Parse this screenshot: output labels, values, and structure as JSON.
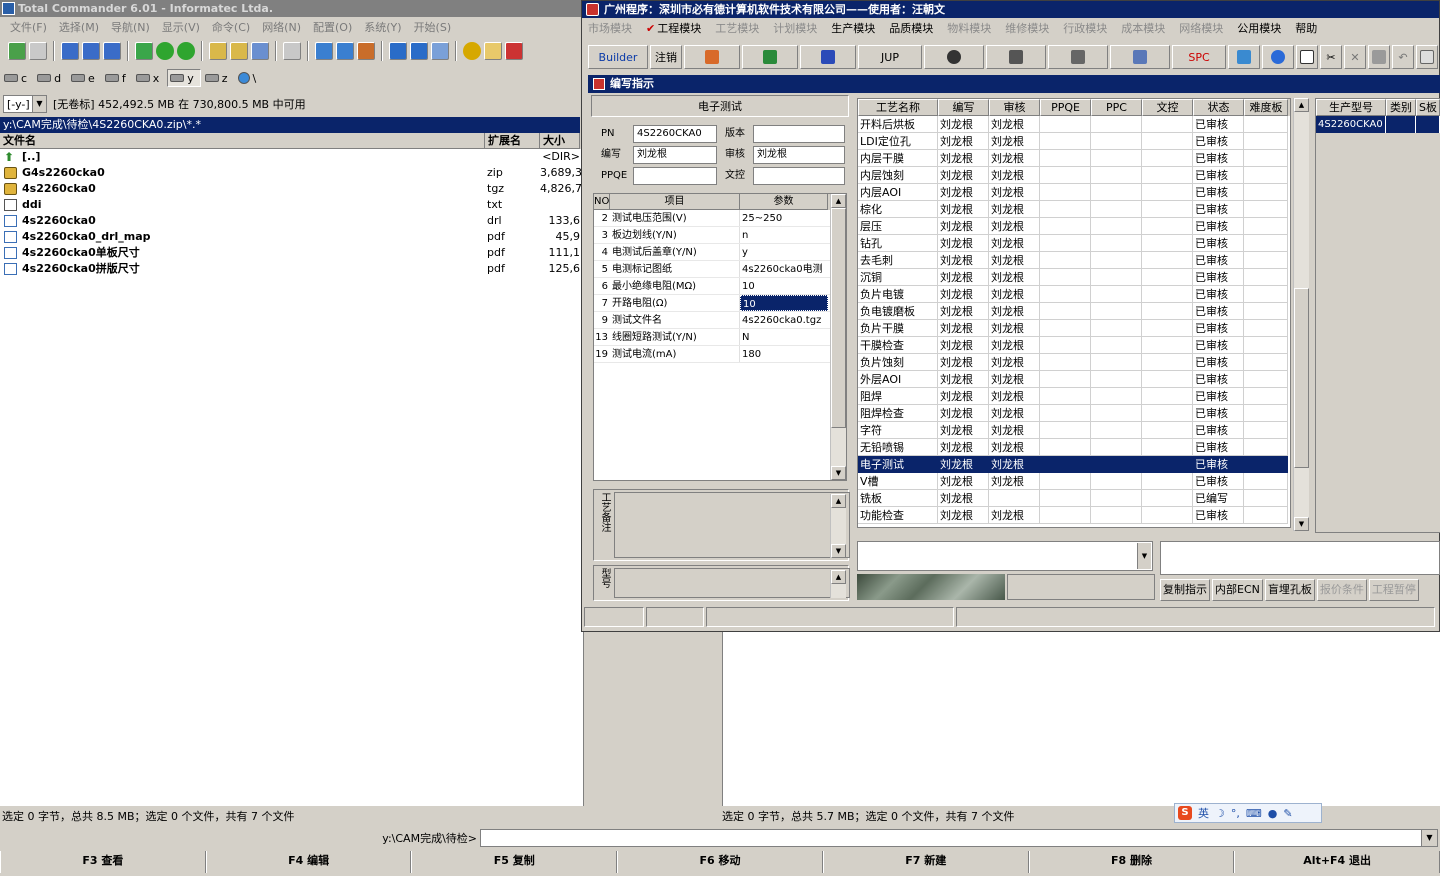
{
  "tc": {
    "title": "Total Commander 6.01 - Informatec Ltda.",
    "menu": [
      "文件(F)",
      "选择(M)",
      "导航(N)",
      "显示(V)",
      "命令(C)",
      "网络(N)",
      "配置(O)",
      "系统(Y)",
      "开始(S)"
    ],
    "drives": [
      "c",
      "d",
      "e",
      "f",
      "x",
      "y",
      "z",
      "\\"
    ],
    "drive_selector": "[-y-]",
    "disk_info": "[无卷标]  452,492.5 MB 在 730,800.5 MB 中可用",
    "current_path": "y:\\CAM完成\\待检\\4S2260CKA0.zip\\*.*",
    "columns": {
      "name": "文件名",
      "ext": "扩展名",
      "size": "大小"
    },
    "files": [
      {
        "name": "[..]",
        "ext": "",
        "size": "<DIR>",
        "icon": "up-arrow"
      },
      {
        "name": "G4s2260cka0",
        "ext": "zip",
        "size": "3,689,3",
        "icon": "archive"
      },
      {
        "name": "4s2260cka0",
        "ext": "tgz",
        "size": "4,826,7",
        "icon": "archive"
      },
      {
        "name": "ddi",
        "ext": "txt",
        "size": "",
        "icon": "text-file"
      },
      {
        "name": "4s2260cka0",
        "ext": "drl",
        "size": "133,6",
        "icon": "file"
      },
      {
        "name": "4s2260cka0_drl_map",
        "ext": "pdf",
        "size": "45,9",
        "icon": "file"
      },
      {
        "name": "4s2260cka0单板尺寸",
        "ext": "pdf",
        "size": "111,1",
        "icon": "file"
      },
      {
        "name": "4s2260cka0拼版尺寸",
        "ext": "pdf",
        "size": "125,6",
        "icon": "file"
      }
    ],
    "status_left": "选定 0 字节，总共 8.5 MB；选定 0 个文件，共有 7 个文件",
    "status_right": "选定 0 字节，总共 5.7 MB；选定 0 个文件，共有 7 个文件",
    "cmd_label": "y:\\CAM完成\\待检>",
    "fkeys": [
      "F3 查看",
      "F4 编辑",
      "F5 复制",
      "F6 移动",
      "F7 新建",
      "F8 删除",
      "Alt+F4 退出"
    ]
  },
  "ime": {
    "lang": "英"
  },
  "erp": {
    "title": "广州程序：深圳市必有德计算机软件技术有限公司——使用者：汪朝文",
    "menu": [
      {
        "label": "市场模块",
        "enabled": false
      },
      {
        "label": "工程模块",
        "enabled": true,
        "checked": true
      },
      {
        "label": "工艺模块",
        "enabled": false
      },
      {
        "label": "计划模块",
        "enabled": false
      },
      {
        "label": "生产模块",
        "enabled": true
      },
      {
        "label": "品质模块",
        "enabled": true
      },
      {
        "label": "物料模块",
        "enabled": false
      },
      {
        "label": "维修模块",
        "enabled": false
      },
      {
        "label": "行政模块",
        "enabled": false
      },
      {
        "label": "成本模块",
        "enabled": false
      },
      {
        "label": "网络模块",
        "enabled": false
      },
      {
        "label": "公用模块",
        "enabled": true
      },
      {
        "label": "帮助",
        "enabled": true
      }
    ],
    "toolbar": {
      "builder": "Builder",
      "logout": "注销",
      "jup": "JUP",
      "spc": "SPC"
    },
    "sub_title": "编写指示",
    "process_name": "电子测试",
    "fields": {
      "pn_label": "PN",
      "pn": "4S2260CKA0",
      "version_label": "版本",
      "version": "",
      "writer_label": "编写",
      "writer": "刘龙根",
      "auditor_label": "审核",
      "auditor": "刘龙根",
      "ppqe_label": "PPQE",
      "ppqe": "",
      "control_label": "文控",
      "control": ""
    },
    "param_columns": {
      "no": "NO",
      "item": "项目",
      "param": "参数"
    },
    "params": [
      {
        "no": "2",
        "item": "测试电压范围(V)",
        "value": "25~250"
      },
      {
        "no": "3",
        "item": "板边划线(Y/N)",
        "value": "n"
      },
      {
        "no": "4",
        "item": "电测试后盖章(Y/N)",
        "value": "y"
      },
      {
        "no": "5",
        "item": "电测标记图纸",
        "value": "4s2260cka0电测"
      },
      {
        "no": "6",
        "item": "最小绝缘电阻(MΩ)",
        "value": "10"
      },
      {
        "no": "7",
        "item": "开路电阻(Ω)",
        "value": "10",
        "selected": true
      },
      {
        "no": "9",
        "item": "测试文件名",
        "value": "4s2260cka0.tgz"
      },
      {
        "no": "13",
        "item": "线圈短路测试(Y/N)",
        "value": "N"
      },
      {
        "no": "19",
        "item": "测试电流(mA)",
        "value": "180"
      }
    ],
    "note_label": "工艺备注",
    "note2_label": "型号",
    "grid_columns": [
      "工艺名称",
      "编写",
      "审核",
      "PPQE",
      "PPC",
      "文控",
      "状态",
      "难度板"
    ],
    "grid_rows": [
      [
        "开料后烘板",
        "刘龙根",
        "刘龙根",
        "",
        "",
        "",
        "已审核",
        ""
      ],
      [
        "LDI定位孔",
        "刘龙根",
        "刘龙根",
        "",
        "",
        "",
        "已审核",
        ""
      ],
      [
        "内层干膜",
        "刘龙根",
        "刘龙根",
        "",
        "",
        "",
        "已审核",
        ""
      ],
      [
        "内层蚀刻",
        "刘龙根",
        "刘龙根",
        "",
        "",
        "",
        "已审核",
        ""
      ],
      [
        "内层AOI",
        "刘龙根",
        "刘龙根",
        "",
        "",
        "",
        "已审核",
        ""
      ],
      [
        "棕化",
        "刘龙根",
        "刘龙根",
        "",
        "",
        "",
        "已审核",
        ""
      ],
      [
        "层压",
        "刘龙根",
        "刘龙根",
        "",
        "",
        "",
        "已审核",
        ""
      ],
      [
        "钻孔",
        "刘龙根",
        "刘龙根",
        "",
        "",
        "",
        "已审核",
        ""
      ],
      [
        "去毛刺",
        "刘龙根",
        "刘龙根",
        "",
        "",
        "",
        "已审核",
        ""
      ],
      [
        "沉铜",
        "刘龙根",
        "刘龙根",
        "",
        "",
        "",
        "已审核",
        ""
      ],
      [
        "负片电镀",
        "刘龙根",
        "刘龙根",
        "",
        "",
        "",
        "已审核",
        ""
      ],
      [
        "负电镀磨板",
        "刘龙根",
        "刘龙根",
        "",
        "",
        "",
        "已审核",
        ""
      ],
      [
        "负片干膜",
        "刘龙根",
        "刘龙根",
        "",
        "",
        "",
        "已审核",
        ""
      ],
      [
        "干膜检查",
        "刘龙根",
        "刘龙根",
        "",
        "",
        "",
        "已审核",
        ""
      ],
      [
        "负片蚀刻",
        "刘龙根",
        "刘龙根",
        "",
        "",
        "",
        "已审核",
        ""
      ],
      [
        "外层AOI",
        "刘龙根",
        "刘龙根",
        "",
        "",
        "",
        "已审核",
        ""
      ],
      [
        "阻焊",
        "刘龙根",
        "刘龙根",
        "",
        "",
        "",
        "已审核",
        ""
      ],
      [
        "阻焊检查",
        "刘龙根",
        "刘龙根",
        "",
        "",
        "",
        "已审核",
        ""
      ],
      [
        "字符",
        "刘龙根",
        "刘龙根",
        "",
        "",
        "",
        "已审核",
        ""
      ],
      [
        "无铅喷锡",
        "刘龙根",
        "刘龙根",
        "",
        "",
        "",
        "已审核",
        ""
      ],
      [
        "电子测试",
        "刘龙根",
        "刘龙根",
        "",
        "",
        "",
        "已审核",
        ""
      ],
      [
        "V槽",
        "刘龙根",
        "刘龙根",
        "",
        "",
        "",
        "已审核",
        ""
      ],
      [
        "铣板",
        "刘龙根",
        "",
        "",
        "",
        "",
        "已编写",
        ""
      ],
      [
        "功能检查",
        "刘龙根",
        "刘龙根",
        "",
        "",
        "",
        "已审核",
        ""
      ]
    ],
    "grid_selected_index": 20,
    "side_columns": [
      "生产型号",
      "类别",
      "S板"
    ],
    "side_rows": [
      [
        "4S2260CKA0",
        "",
        ""
      ]
    ],
    "tabs": [
      {
        "label": "复制指示",
        "enabled": true
      },
      {
        "label": "内部ECN",
        "enabled": true
      },
      {
        "label": "盲埋孔板",
        "enabled": true
      },
      {
        "label": "报价条件",
        "enabled": false
      },
      {
        "label": "工程暂停",
        "enabled": false
      }
    ]
  }
}
